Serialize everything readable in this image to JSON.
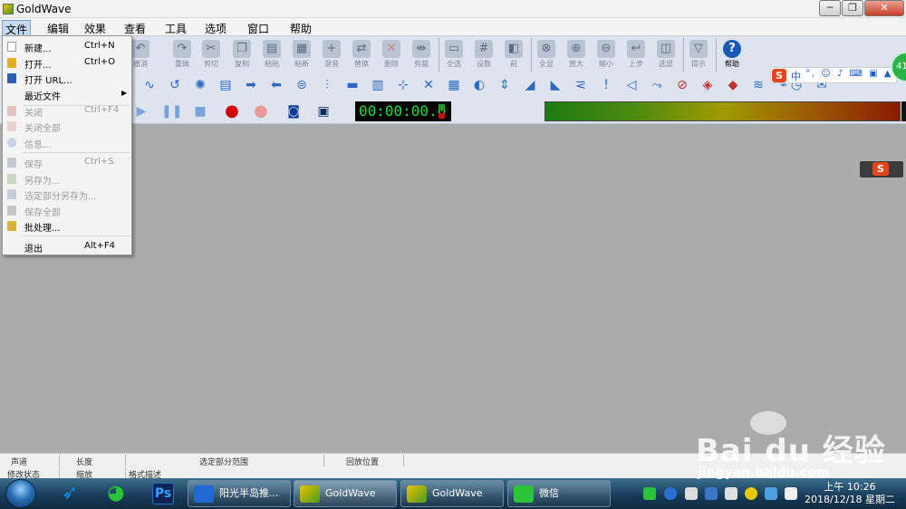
{
  "window": {
    "title": "GoldWave",
    "close_label": "✕",
    "max_label": "❐",
    "min_label": "─"
  },
  "menubar": [
    "文件",
    "编辑",
    "效果",
    "查看",
    "工具",
    "选项",
    "窗口",
    "帮助"
  ],
  "toolbar": {
    "buttons": [
      "撤消",
      "重做",
      "剪切",
      "复制",
      "粘贴",
      "粘新",
      "混音",
      "替换",
      "删除",
      "剪裁",
      "全选",
      "设数",
      "前",
      "全显",
      "放大",
      "缩小",
      "上步",
      "选显",
      "提示"
    ],
    "help_label": "帮助"
  },
  "transport": {
    "time": "00:00:00.0"
  },
  "file_menu": {
    "items": [
      {
        "label": "新建...",
        "shortcut": "Ctrl+N",
        "enabled": true
      },
      {
        "label": "打开...",
        "shortcut": "Ctrl+O",
        "enabled": true
      },
      {
        "label": "打开 URL...",
        "shortcut": "",
        "enabled": true
      },
      {
        "label": "最近文件",
        "shortcut": "",
        "enabled": true,
        "submenu": true
      },
      {
        "label": "关闭",
        "shortcut": "Ctrl+F4",
        "enabled": false
      },
      {
        "label": "关闭全部",
        "shortcut": "",
        "enabled": false
      },
      {
        "label": "信息...",
        "shortcut": "",
        "enabled": false
      },
      {
        "label": "保存",
        "shortcut": "Ctrl+S",
        "enabled": false
      },
      {
        "label": "另存为...",
        "shortcut": "",
        "enabled": false
      },
      {
        "label": "选定部分另存为...",
        "shortcut": "",
        "enabled": false
      },
      {
        "label": "保存全部",
        "shortcut": "",
        "enabled": false
      },
      {
        "label": "批处理...",
        "shortcut": "",
        "enabled": true
      },
      {
        "label": "退出",
        "shortcut": "Alt+F4",
        "enabled": true
      }
    ]
  },
  "statusbar": {
    "row1": [
      "声道",
      "长度",
      "选定部分范围",
      "回放位置"
    ],
    "row2": [
      "修改状态",
      "缩放",
      "格式描述"
    ]
  },
  "ime": {
    "logo": "S",
    "mode": "中",
    "tools": "°, ☺ ♪ ⌨ ▣ ▲"
  },
  "taskbar": {
    "tasks": [
      "阳光半岛推...",
      "GoldWave",
      "GoldWave",
      "微信"
    ],
    "ps_label": "Ps",
    "clock_time": "上午 10:26",
    "clock_date": "2018/12/18 星期二"
  },
  "watermark": {
    "brand": "Bai du 经验",
    "url": "jingyan.baidu.com"
  },
  "colors": {
    "workspace": "#ababab",
    "toolbar": "#dde4ef",
    "time_text": "#1fe040",
    "ime_logo": "#e8451c"
  }
}
